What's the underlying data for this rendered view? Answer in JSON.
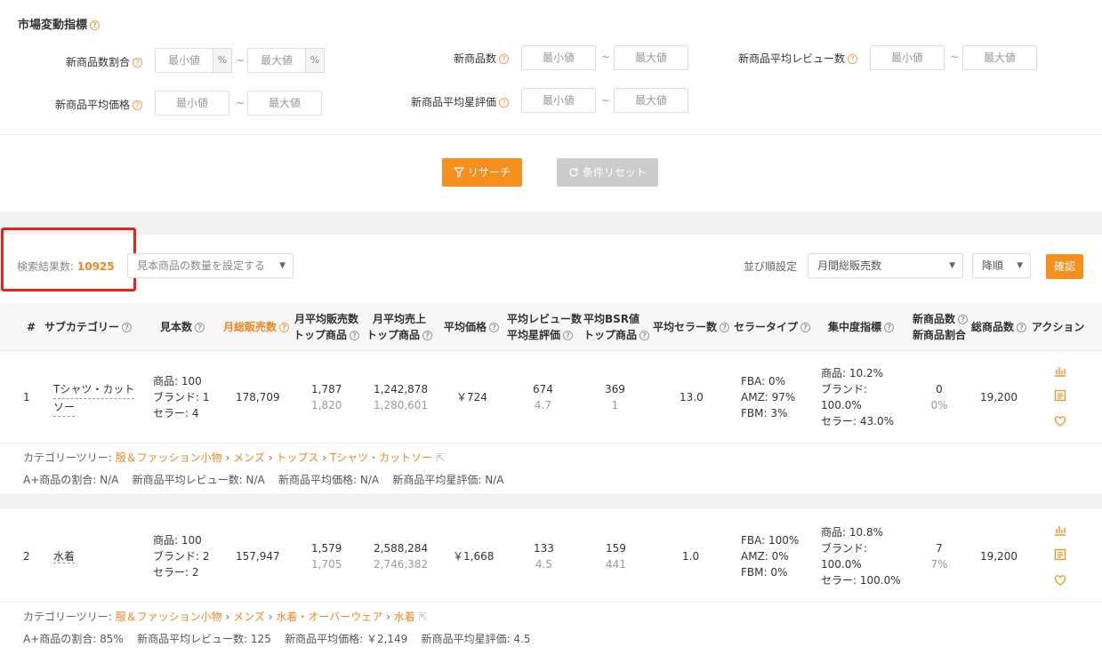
{
  "filters": {
    "section_title": "市場変動指標",
    "new_ratio_label": "新商品数割合",
    "new_count_label": "新商品数",
    "new_avg_review_label": "新商品平均レビュー数",
    "new_avg_price_label": "新商品平均価格",
    "new_avg_rating_label": "新商品平均星評価",
    "min_placeholder": "最小値",
    "max_placeholder": "最大値",
    "percent": "%",
    "tilde": "~"
  },
  "actions": {
    "research": "リサーチ",
    "reset": "条件リセット"
  },
  "results": {
    "count_label": "検索結果数:",
    "count_value": "10925",
    "sample_placeholder": "見本商品の数量を設定する",
    "sort_label": "並び順設定",
    "sort_value": "月間総販売数",
    "order_value": "降順",
    "confirm": "確認"
  },
  "table": {
    "headers": {
      "num": "#",
      "subcat": "サブカテゴリー",
      "sample": "見本数",
      "monthly_sales": "月総販売数",
      "avg_sales_1": "月平均販売数",
      "avg_sales_2": "トップ商品",
      "avg_rev_1": "月平均売上",
      "avg_rev_2": "トップ商品",
      "avg_price": "平均価格",
      "avg_review_1": "平均レビュー数",
      "avg_review_2": "平均星評価",
      "avg_bsr_1": "平均BSR値",
      "avg_bsr_2": "トップ商品",
      "avg_sellers": "平均セラー数",
      "seller_type": "セラータイプ",
      "concentration": "集中度指標",
      "new_1": "新商品数",
      "new_2": "新商品割合",
      "total": "総商品数",
      "action": "アクション"
    },
    "rows": [
      {
        "num": "1",
        "name_1": "Tシャツ・カット",
        "name_2": "ソー",
        "sample_products": "商品: 100",
        "sample_brands": "ブランド: 1",
        "sample_sellers": "セラー: 4",
        "monthly_sales": "178,709",
        "avg_sales": "1,787",
        "avg_sales_top": "1,820",
        "avg_rev": "1,242,878",
        "avg_rev_top": "1,280,601",
        "avg_price": "￥724",
        "avg_review": "674",
        "avg_rating": "4.7",
        "avg_bsr": "369",
        "avg_bsr_top": "1",
        "avg_sellers": "13.0",
        "fba": "FBA: 0%",
        "amz": "AMZ: 97%",
        "fbm": "FBM: 3%",
        "conc_products": "商品: 10.2%",
        "conc_brand_label": "ブランド:",
        "conc_brand_value": "100.0%",
        "conc_sellers": "セラー: 43.0%",
        "new_count": "0",
        "new_ratio": "0%",
        "total": "19,200",
        "tree_label": "カテゴリーツリー:",
        "tree_1": "服＆ファッション小物",
        "tree_2": "メンズ",
        "tree_3": "トップス",
        "tree_4": "Tシャツ・カットソー",
        "aplus": "A+商品の割合: N/A",
        "new_avg_review": "新商品平均レビュー数: N/A",
        "new_avg_price": "新商品平均価格: N/A",
        "new_avg_rating": "新商品平均星評価: N/A"
      },
      {
        "num": "2",
        "name_1": "水着",
        "sample_products": "商品: 100",
        "sample_brands": "ブランド: 2",
        "sample_sellers": "セラー: 2",
        "monthly_sales": "157,947",
        "avg_sales": "1,579",
        "avg_sales_top": "1,705",
        "avg_rev": "2,588,284",
        "avg_rev_top": "2,746,382",
        "avg_price": "￥1,668",
        "avg_review": "133",
        "avg_rating": "4.5",
        "avg_bsr": "159",
        "avg_bsr_top": "441",
        "avg_sellers": "1.0",
        "fba": "FBA: 100%",
        "amz": "AMZ: 0%",
        "fbm": "FBM: 0%",
        "conc_products": "商品: 10.8%",
        "conc_brand_label": "ブランド:",
        "conc_brand_value": "100.0%",
        "conc_sellers": "セラー: 100.0%",
        "new_count": "7",
        "new_ratio": "7%",
        "total": "19,200",
        "tree_label": "カテゴリーツリー:",
        "tree_1": "服＆ファッション小物",
        "tree_2": "メンズ",
        "tree_3": "水着・オーバーウェア",
        "tree_4": "水着",
        "aplus": "A+商品の割合: 85%",
        "new_avg_review": "新商品平均レビュー数: 125",
        "new_avg_price": "新商品平均価格: ￥2,149",
        "new_avg_rating": "新商品平均星評価: 4.5"
      }
    ],
    "sep": "›"
  },
  "colors": {
    "accent": "#f5901e",
    "highlight_box": "#e8231d",
    "disabled_btn": "#cccccc"
  }
}
